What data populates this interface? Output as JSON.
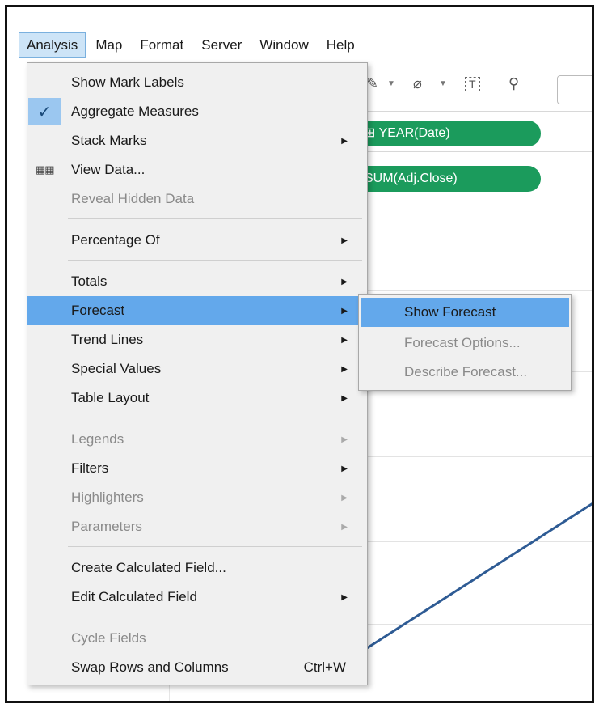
{
  "menubar": {
    "items": [
      "Analysis",
      "Map",
      "Format",
      "Server",
      "Window",
      "Help"
    ],
    "active": "Analysis"
  },
  "toolbar": {
    "icons": [
      "pen-icon",
      "caret-down-icon",
      "paperclip-icon",
      "caret-down-icon",
      "text-box-icon",
      "pin-icon"
    ],
    "text_icon_glyph": "T"
  },
  "shelves": {
    "columns_pill": "⊞ YEAR(Date)",
    "rows_pill": "SUM(Adj.Close)"
  },
  "analysis_menu": {
    "items": [
      {
        "label": "Show Mark Labels"
      },
      {
        "label": "Aggregate Measures",
        "checked": true
      },
      {
        "label": "Stack Marks",
        "submenu": true
      },
      {
        "label": "View Data...",
        "icon": "table-icon"
      },
      {
        "label": "Reveal Hidden Data",
        "disabled": true
      },
      {
        "label": "Percentage Of",
        "submenu": true
      },
      {
        "label": "Totals",
        "submenu": true
      },
      {
        "label": "Forecast",
        "submenu": true,
        "highlighted": true
      },
      {
        "label": "Trend Lines",
        "submenu": true
      },
      {
        "label": "Special Values",
        "submenu": true
      },
      {
        "label": "Table Layout",
        "submenu": true
      },
      {
        "label": "Legends",
        "submenu": true,
        "disabled": true
      },
      {
        "label": "Filters",
        "submenu": true
      },
      {
        "label": "Highlighters",
        "submenu": true,
        "disabled": true
      },
      {
        "label": "Parameters",
        "submenu": true,
        "disabled": true
      },
      {
        "label": "Create Calculated Field..."
      },
      {
        "label": "Edit Calculated Field",
        "submenu": true
      },
      {
        "label": "Cycle Fields",
        "disabled": true
      },
      {
        "label": "Swap Rows and Columns",
        "shortcut": "Ctrl+W"
      }
    ]
  },
  "forecast_submenu": {
    "items": [
      {
        "label": "Show Forecast",
        "highlighted": true
      },
      {
        "label": "Forecast Options...",
        "disabled": true
      },
      {
        "label": "Describe Forecast...",
        "disabled": true
      }
    ]
  },
  "colors": {
    "highlight": "#63a8eb",
    "pill": "#1b9b5c",
    "line": "#2e5b94"
  }
}
